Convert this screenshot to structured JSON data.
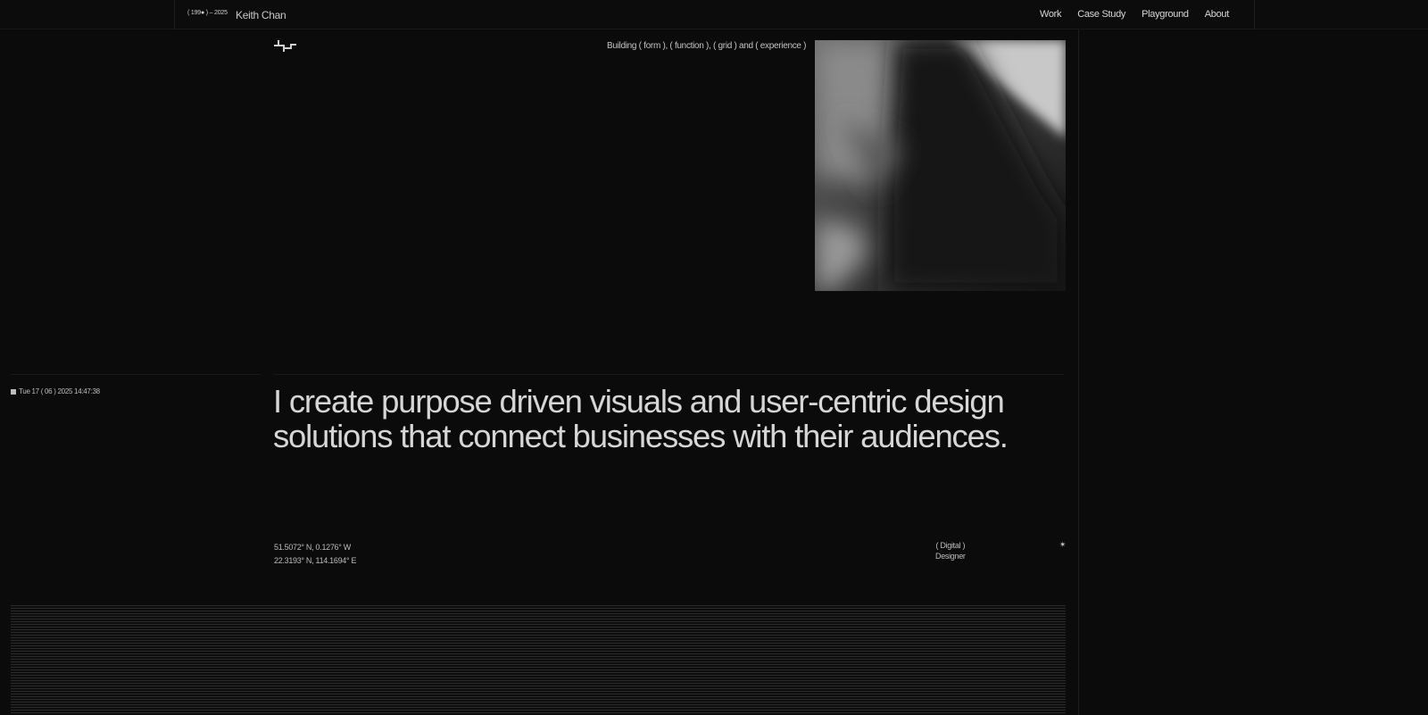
{
  "header": {
    "years": "( 199● ) – 2025",
    "name": "Keith Chan",
    "nav": [
      "Work",
      "Case Study",
      "Playground",
      "About"
    ]
  },
  "hero": {
    "tagline": "Building ( form ), ( function ), ( grid ) and ( experience )",
    "image_alt": "blurred black and white photo",
    "clock": "Tue 17 ( 06 ) 2025 14:47:38",
    "headline_line1": "I create purpose driven visuals and user-centric design",
    "headline_line2": "solutions that connect businesses with their audiences.",
    "coords_1": "51.5072° N, 0.1276° W",
    "coords_2": "22.3193° N, 114.1694° E",
    "role_1": "( Digital )",
    "role_2": "Designer",
    "spark_icon": "✴"
  },
  "colors": {
    "background": "#0b0b0b",
    "text": "#d6d6d6"
  }
}
